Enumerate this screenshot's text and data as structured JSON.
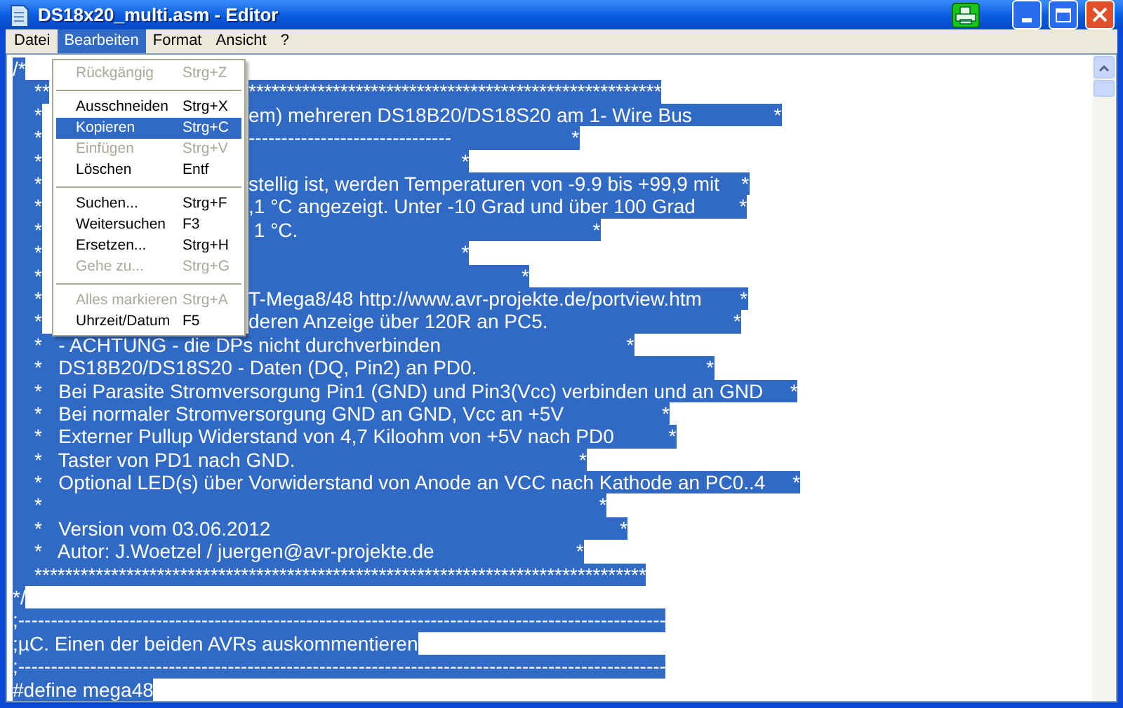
{
  "window": {
    "title": "DS18x20_multi.asm - Editor"
  },
  "menu_bar": [
    {
      "label": "Datei",
      "selected": false
    },
    {
      "label": "Bearbeiten",
      "selected": true
    },
    {
      "label": "Format",
      "selected": false
    },
    {
      "label": "Ansicht",
      "selected": false
    },
    {
      "label": "?",
      "selected": false
    }
  ],
  "edit_menu": [
    {
      "kind": "item",
      "label": "Rückgängig",
      "shortcut": "Strg+Z",
      "disabled": true,
      "selected": false
    },
    {
      "kind": "separator"
    },
    {
      "kind": "item",
      "label": "Ausschneiden",
      "shortcut": "Strg+X",
      "disabled": false,
      "selected": false
    },
    {
      "kind": "item",
      "label": "Kopieren",
      "shortcut": "Strg+C",
      "disabled": false,
      "selected": true
    },
    {
      "kind": "item",
      "label": "Einfügen",
      "shortcut": "Strg+V",
      "disabled": true,
      "selected": false
    },
    {
      "kind": "item",
      "label": "Löschen",
      "shortcut": "Entf",
      "disabled": false,
      "selected": false
    },
    {
      "kind": "separator"
    },
    {
      "kind": "item",
      "label": "Suchen...",
      "shortcut": "Strg+F",
      "disabled": false,
      "selected": false
    },
    {
      "kind": "item",
      "label": "Weitersuchen",
      "shortcut": "F3",
      "disabled": false,
      "selected": false
    },
    {
      "kind": "item",
      "label": "Ersetzen...",
      "shortcut": "Strg+H",
      "disabled": false,
      "selected": false
    },
    {
      "kind": "item",
      "label": "Gehe zu...",
      "shortcut": "Strg+G",
      "disabled": true,
      "selected": false
    },
    {
      "kind": "separator"
    },
    {
      "kind": "item",
      "label": "Alles markieren",
      "shortcut": "Strg+A",
      "disabled": true,
      "selected": false
    },
    {
      "kind": "item",
      "label": "Uhrzeit/Datum",
      "shortcut": "F5",
      "disabled": false,
      "selected": false
    }
  ],
  "editor_lines": [
    {
      "text": "/*",
      "selected": true
    },
    {
      "left": "    **",
      "right": "******************************************************",
      "selected": true
    },
    {
      "left": "    *",
      "right": "em) mehreren DS18B20/DS18S20 am 1- Wire Bus               *",
      "selected": true
    },
    {
      "left": "    *",
      "right": "-------------------------------                      *",
      "selected": true
    },
    {
      "left": "    *",
      "right": "                                       *",
      "selected": true
    },
    {
      "left": "    *",
      "right": "stellig ist, werden Temperaturen von -9.9 bis +99,9 mit    *",
      "selected": true
    },
    {
      "left": "    *",
      "right": ",1 °C angezeigt. Unter -10 Grad und über 100 Grad        *",
      "selected": true
    },
    {
      "left": "    *",
      "right": " 1 °C.                                                      *",
      "selected": true
    },
    {
      "left": "    *",
      "right": "                                       *",
      "selected": true
    },
    {
      "left": "    *",
      "right": "                                                  *",
      "selected": true
    },
    {
      "left": "    *",
      "right": "T-Mega8/48 http://www.avr-projekte.de/portview.htm       *",
      "selected": true
    },
    {
      "left": "    *",
      "right": "deren Anzeige über 120R an PC5.                                  *",
      "selected": true
    },
    {
      "text": "    *   - ACHTUNG - die DPs nicht durchverbinden                                  *",
      "selected": true
    },
    {
      "text": "    *   DS18B20/DS18S20 - Daten (DQ, Pin2) an PD0.                                          *",
      "selected": true
    },
    {
      "text": "    *   Bei Parasite Stromversorgung Pin1 (GND) und Pin3(Vcc) verbinden und an GND     *",
      "selected": true
    },
    {
      "text": "    *   Bei normaler Stromversorgung GND an GND, Vcc an +5V                  *",
      "selected": true
    },
    {
      "text": "    *   Externer Pullup Widerstand von 4,7 Kiloohm von +5V nach PD0          *",
      "selected": true
    },
    {
      "text": "    *   Taster von PD1 nach GND.                                                    *",
      "selected": true
    },
    {
      "text": "    *   Optional LED(s) über Vorwiderstand von Anode an VCC nach Kathode an PC0..4     *",
      "selected": true
    },
    {
      "text": "    *                                                                                                      *",
      "selected": true
    },
    {
      "text": "    *   Version vom 03.06.2012                                                                *",
      "selected": true
    },
    {
      "text": "    *   Autor: J.Woetzel / juergen@avr-projekte.de                          *",
      "selected": true
    },
    {
      "text": "    ********************************************************************************",
      "selected": true
    },
    {
      "text": "*/",
      "selected": true
    },
    {
      "text": ";---------------------------------------------------------------------------------------------------",
      "selected": true
    },
    {
      "text": ";µC. Einen der beiden AVRs auskommentieren",
      "selected": true
    },
    {
      "text": ";---------------------------------------------------------------------------------------------------",
      "selected": true
    },
    {
      "text": "#define mega48",
      "selected": true
    }
  ]
}
